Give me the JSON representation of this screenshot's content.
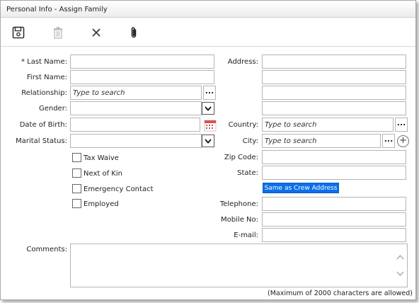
{
  "window": {
    "title": "Personal Info - Assign Family"
  },
  "toolbar": {
    "save_icon": "floppy-disk-icon",
    "delete_icon": "trash-icon",
    "close_icon": "close-x-icon",
    "attach_icon": "paperclip-icon"
  },
  "left": {
    "last_name_label": "* Last Name:",
    "first_name_label": "First Name:",
    "relationship_label": "Relationship:",
    "relationship_placeholder": "Type to search",
    "gender_label": "Gender:",
    "dob_label": "Date of Birth:",
    "marital_label": "Marital Status:"
  },
  "checkboxes": [
    {
      "label": "Tax Waive"
    },
    {
      "label": "Next of Kin"
    },
    {
      "label": "Emergency Contact"
    },
    {
      "label": "Employed"
    }
  ],
  "right": {
    "address_label": "Address:",
    "country_label": "Country:",
    "country_placeholder": "Type to search",
    "city_label": "City:",
    "city_placeholder": "Type to search",
    "zip_label": "Zip Code:",
    "state_label": "State:",
    "same_as_label": "Same as Crew Address",
    "telephone_label": "Telephone:",
    "mobile_label": "Mobile No:",
    "email_label": "E-mail:"
  },
  "comments": {
    "label": "Comments:",
    "note": "(Maximum of 2000 characters are allowed)"
  },
  "buttons": {
    "dots": "...",
    "plus": "+"
  },
  "colors": {
    "accent": "#0b6fe8",
    "calendar": "#d9534f"
  }
}
